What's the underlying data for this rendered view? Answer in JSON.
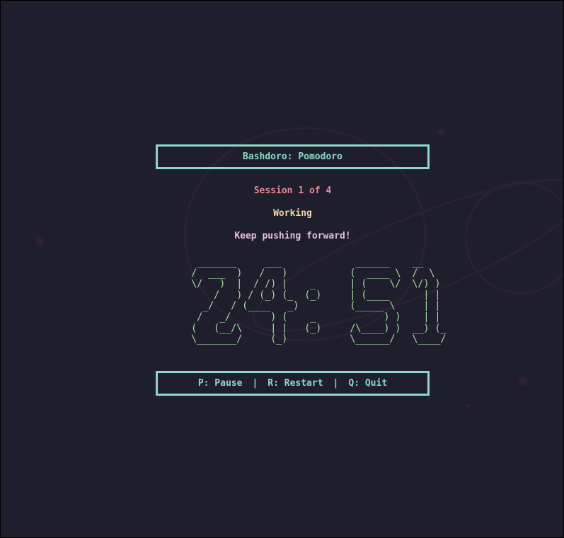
{
  "app": {
    "title": "Bashdoro: Pomodoro"
  },
  "session": {
    "label": "Session 1 of 4",
    "status": "Working",
    "message": "Keep pushing forward!"
  },
  "timer": {
    "display": "24:51",
    "ascii_art": "   _______     ___             ______    __\n  /  ___  )   /   )           (  ____ \\  /  \\\n  \\/   )  |  / /) |    _      | (    \\/  \\/) )\n      /   ) / (_) (_  (_)     | (____      | |\n    _/   / (____   _)         (_____ \\     | |\n   /   _/       ) (    _            ) )    | |\n  (   (__/\\     | |   (_)     /\\____) )  __) (_\n  \\_______/     (_)           \\______/   \\____/"
  },
  "controls": {
    "pause": "P: Pause",
    "restart": "R: Restart",
    "quit": "Q: Quit",
    "separator": "|"
  },
  "colors": {
    "background": "#1e1e2c",
    "accent": "#8fd8c8",
    "session": "#e8889a",
    "status": "#f2d4a6",
    "message": "#e6bfe0",
    "timer": "#a6dba0"
  }
}
